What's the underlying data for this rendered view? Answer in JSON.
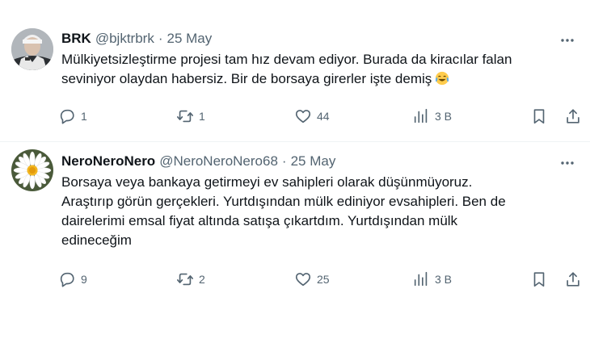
{
  "tweets": [
    {
      "name": "BRK",
      "handle": "@bjktrbrk",
      "separator": "·",
      "date": "25 May",
      "lines": [
        "Mülkiyetsizleştirme projesi tam hız devam ediyor. Burada da kiracılar falan",
        "seviniyor olaydan habersiz. Bir de borsaya girerler işte demiş"
      ],
      "emoji": "face-with-tears-of-joy",
      "avatar": "profile-photo",
      "replies": "1",
      "reposts": "1",
      "likes": "44",
      "views": "3 B"
    },
    {
      "name": "NeroNeroNero",
      "handle": "@NeroNeroNero68",
      "separator": "·",
      "date": "25 May",
      "lines": [
        "Borsaya veya bankaya getirmeyi ev sahipleri olarak düşünmüyoruz.",
        "Araştırıp görün gerçekleri. Yurtdışından mülk ediniyor evsahipleri. Ben de",
        "dairelerimi emsal fiyat altında satışa çıkartdım. Yurtdışından mülk",
        "edineceğim"
      ],
      "avatar": "daisy-flower",
      "replies": "9",
      "reposts": "2",
      "likes": "25",
      "views": "3 B"
    }
  ],
  "icons": {
    "more": "more-horizontal-icon",
    "reply": "reply-icon",
    "repost": "repost-icon",
    "like": "like-icon",
    "views": "views-icon",
    "bookmark": "bookmark-icon",
    "share": "share-icon"
  },
  "colors": {
    "text": "#0f1419",
    "secondary": "#536471",
    "divider": "#eff3f4"
  }
}
